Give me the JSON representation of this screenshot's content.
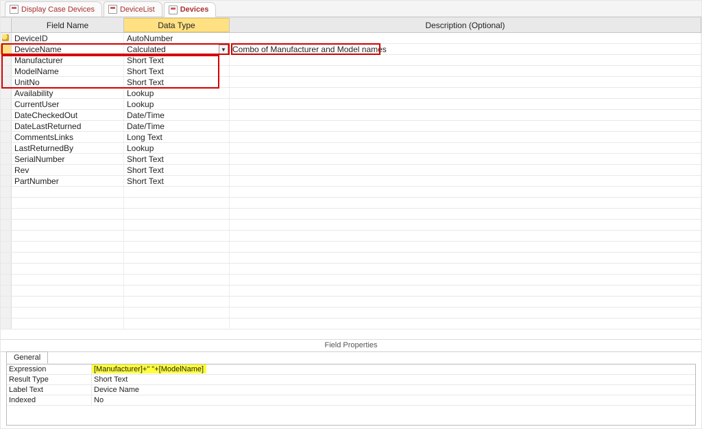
{
  "tabs": [
    {
      "label": "Display Case Devices",
      "active": false
    },
    {
      "label": "DeviceList",
      "active": false
    },
    {
      "label": "Devices",
      "active": true
    }
  ],
  "columns": {
    "field": "Field Name",
    "type": "Data Type",
    "desc": "Description (Optional)"
  },
  "fields": [
    {
      "name": "DeviceID",
      "type": "AutoNumber",
      "desc": "",
      "pk": true,
      "selected": false
    },
    {
      "name": "DeviceName",
      "type": "Calculated",
      "desc": "Combo of Manufacturer and Model names",
      "pk": false,
      "selected": true
    },
    {
      "name": "Manufacturer",
      "type": "Short Text",
      "desc": "",
      "pk": false,
      "selected": false
    },
    {
      "name": "ModelName",
      "type": "Short Text",
      "desc": "",
      "pk": false,
      "selected": false
    },
    {
      "name": "UnitNo",
      "type": "Short Text",
      "desc": "",
      "pk": false,
      "selected": false
    },
    {
      "name": "Availability",
      "type": "Lookup",
      "desc": "",
      "pk": false,
      "selected": false
    },
    {
      "name": "CurrentUser",
      "type": "Lookup",
      "desc": "",
      "pk": false,
      "selected": false
    },
    {
      "name": "DateCheckedOut",
      "type": "Date/Time",
      "desc": "",
      "pk": false,
      "selected": false
    },
    {
      "name": "DateLastReturned",
      "type": "Date/Time",
      "desc": "",
      "pk": false,
      "selected": false
    },
    {
      "name": "CommentsLinks",
      "type": "Long Text",
      "desc": "",
      "pk": false,
      "selected": false
    },
    {
      "name": "LastReturnedBy",
      "type": "Lookup",
      "desc": "",
      "pk": false,
      "selected": false
    },
    {
      "name": "SerialNumber",
      "type": "Short Text",
      "desc": "",
      "pk": false,
      "selected": false
    },
    {
      "name": "Rev",
      "type": "Short Text",
      "desc": "",
      "pk": false,
      "selected": false
    },
    {
      "name": "PartNumber",
      "type": "Short Text",
      "desc": "",
      "pk": false,
      "selected": false
    }
  ],
  "blank_rows": 13,
  "properties_title": "Field Properties",
  "properties_tab": "General",
  "properties": [
    {
      "label": "Expression",
      "value": "[Manufacturer]+\" \"+[ModelName]",
      "highlight": true
    },
    {
      "label": "Result Type",
      "value": "Short Text",
      "highlight": false
    },
    {
      "label": "Label Text",
      "value": "Device Name",
      "highlight": false
    },
    {
      "label": "Indexed",
      "value": "No",
      "highlight": false
    }
  ]
}
